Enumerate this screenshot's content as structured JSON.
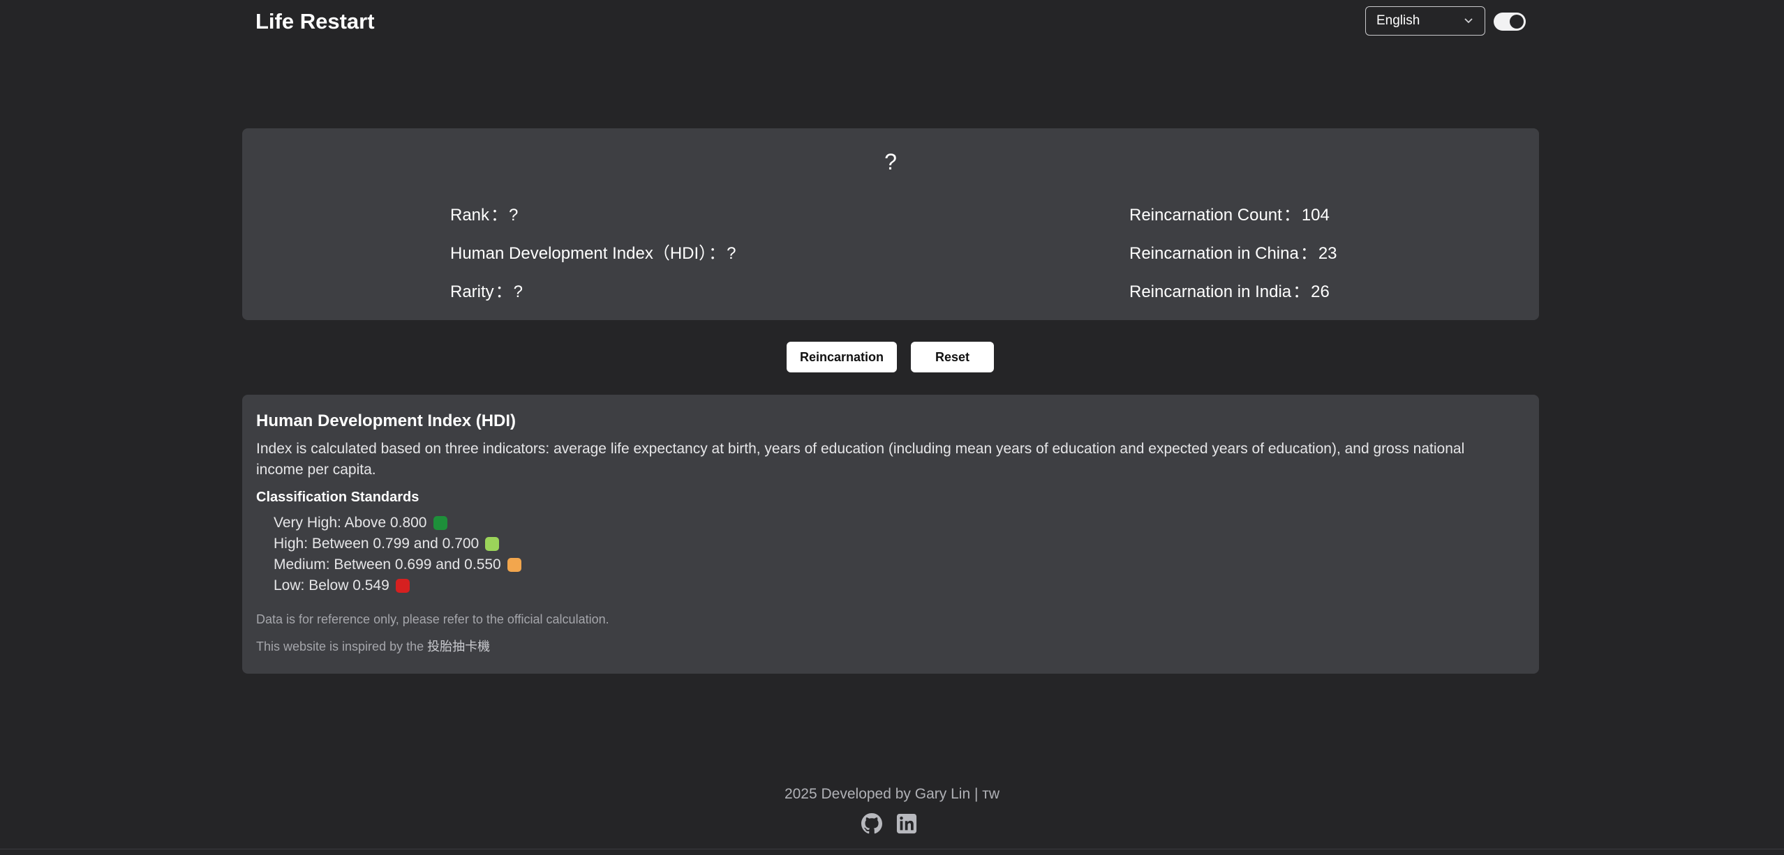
{
  "header": {
    "app_title": "Life Restart",
    "language_selected": "English",
    "theme_toggle_on": true
  },
  "result": {
    "name": "?",
    "rank_label": "Rank",
    "rank_value": "?",
    "hdi_label": "Human Development Index（HDI）",
    "hdi_value": "?",
    "rarity_label": "Rarity",
    "rarity_value": "?",
    "count_label": "Reincarnation Count",
    "count_value": "104",
    "china_label": "Reincarnation in China",
    "china_value": "23",
    "india_label": "Reincarnation in India",
    "india_value": "26",
    "separator": "："
  },
  "actions": {
    "reincarnation_label": "Reincarnation",
    "reset_label": "Reset"
  },
  "info": {
    "title": "Human Development Index (HDI)",
    "description": "Index is calculated based on three indicators: average life expectancy at birth, years of education (including mean years of education and expected years of education), and gross national income per capita.",
    "classification_title": "Classification Standards",
    "levels": [
      {
        "label": "Very High: Above 0.800",
        "color": "#1e8f3a"
      },
      {
        "label": "High: Between 0.799 and 0.700",
        "color": "#9bd45a"
      },
      {
        "label": "Medium: Between 0.699 and 0.550",
        "color": "#f2a64d"
      },
      {
        "label": "Low: Below 0.549",
        "color": "#d62020"
      }
    ],
    "note": "Data is for reference only, please refer to the official calculation.",
    "inspired_prefix": "This website is inspired by the",
    "inspired_link": "投胎抽卡機"
  },
  "footer": {
    "text": "2025 Developed by Gary Lin | ᴛᴡ",
    "icons": [
      "github-icon",
      "linkedin-icon"
    ]
  }
}
